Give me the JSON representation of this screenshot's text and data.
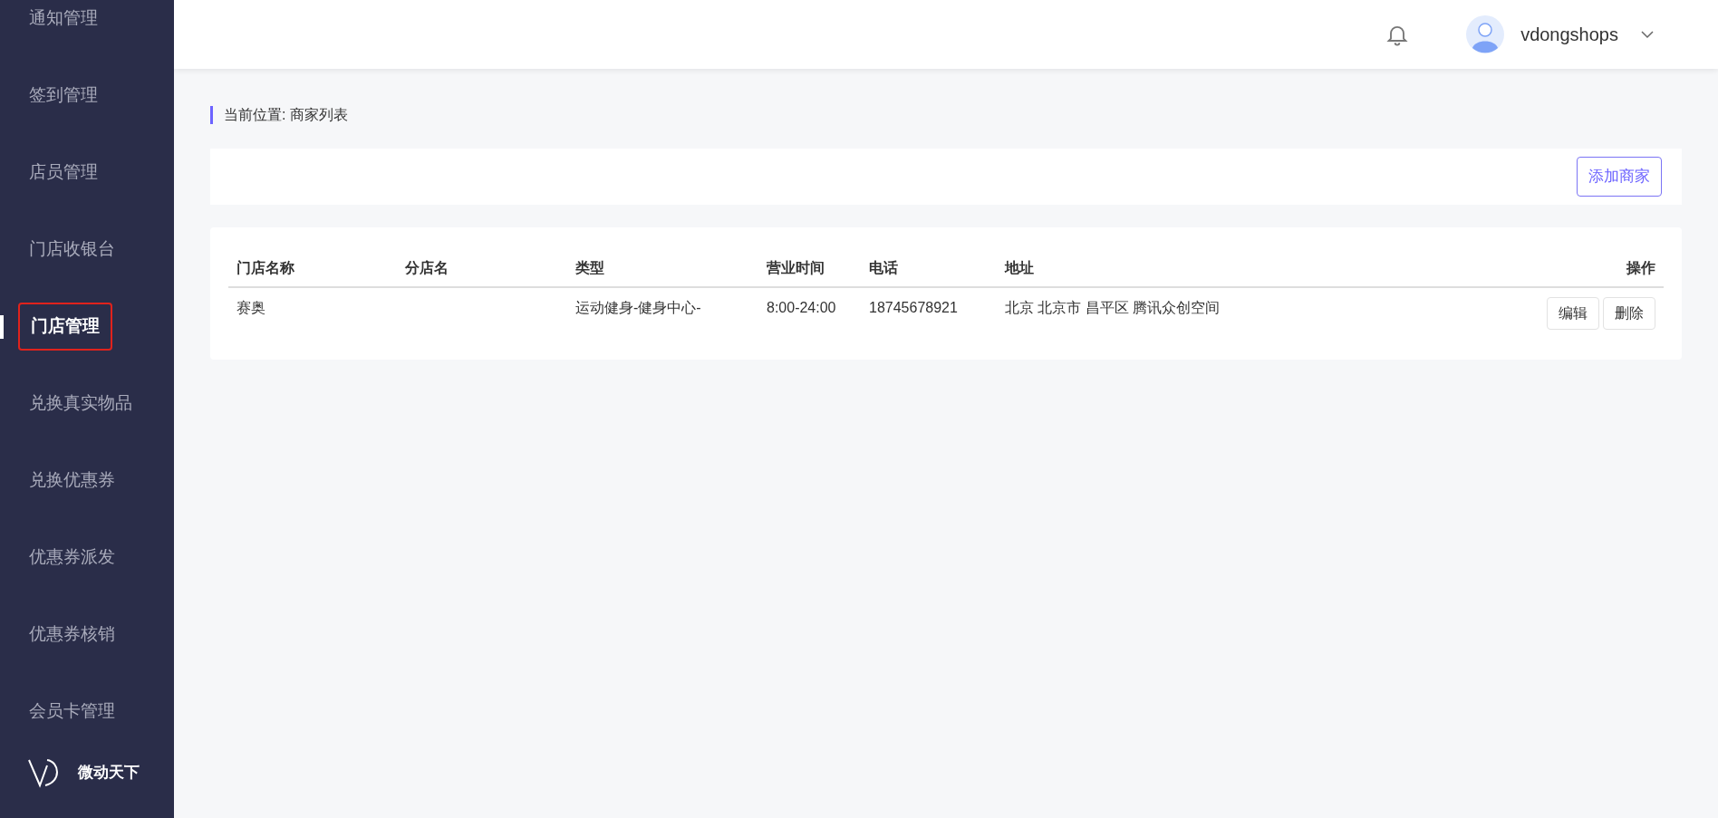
{
  "sidebar": {
    "items": [
      {
        "label": "通知管理",
        "selected": false
      },
      {
        "label": "签到管理",
        "selected": false
      },
      {
        "label": "店员管理",
        "selected": false
      },
      {
        "label": "门店收银台",
        "selected": false
      },
      {
        "label": "门店管理",
        "selected": true
      },
      {
        "label": "兑换真实物品",
        "selected": false
      },
      {
        "label": "兑换优惠券",
        "selected": false
      },
      {
        "label": "优惠券派发",
        "selected": false
      },
      {
        "label": "优惠券核销",
        "selected": false
      },
      {
        "label": "会员卡管理",
        "selected": false
      }
    ],
    "brand": "微动天下"
  },
  "header": {
    "username": "vdongshops"
  },
  "breadcrumb": {
    "label": "当前位置:",
    "current": "商家列表"
  },
  "toolbar": {
    "add_button": "添加商家"
  },
  "table": {
    "columns": [
      "门店名称",
      "分店名",
      "类型",
      "营业时间",
      "电话",
      "地址",
      "操作"
    ],
    "rows": [
      {
        "cells": [
          "赛奥",
          "",
          "运动健身-健身中心-",
          "8:00-24:00",
          "18745678921",
          "北京 北京市 昌平区 腾讯众创空间"
        ],
        "actions": [
          "编辑",
          "删除"
        ]
      }
    ]
  }
}
